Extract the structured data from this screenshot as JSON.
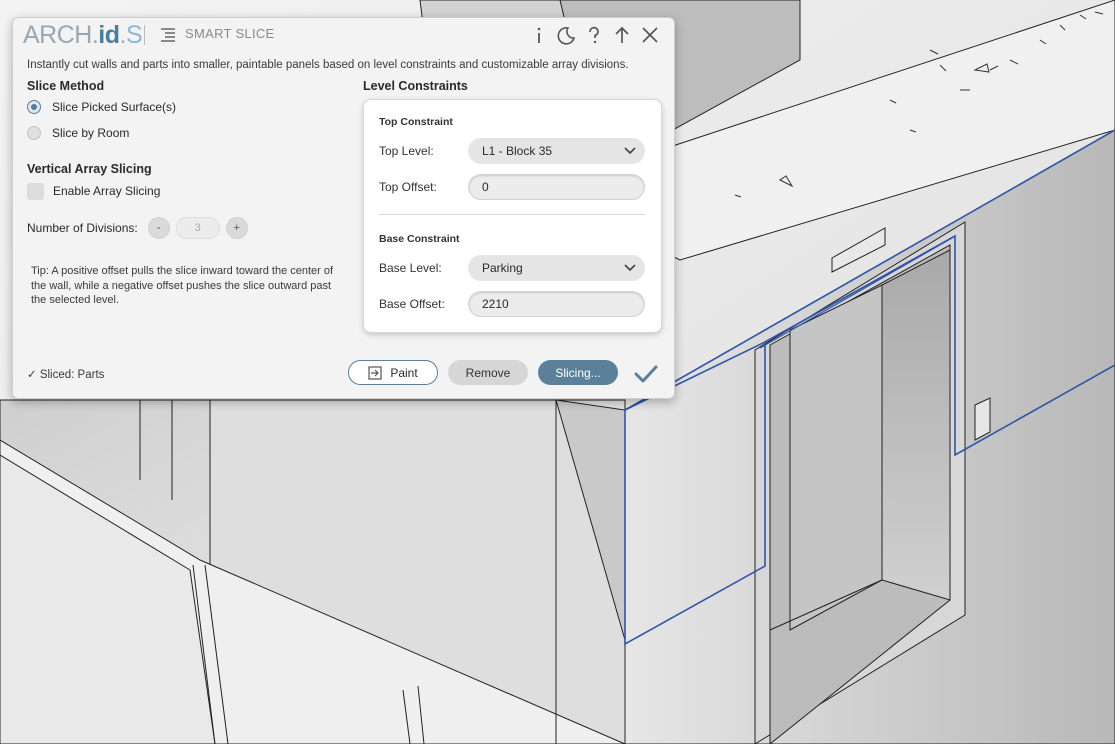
{
  "app": {
    "logo_prefix": "ARCH.",
    "logo_mid": "id",
    "logo_suffix": ".S",
    "title": "SMART SLICE",
    "description": "Instantly cut walls and parts into smaller, paintable panels based on level constraints and customizable array divisions."
  },
  "titlebar_icons": [
    "menu-icon",
    "info-icon",
    "dark-mode-icon",
    "help-icon",
    "collapse-icon",
    "close-icon"
  ],
  "slice_method": {
    "label": "Slice Method",
    "options": [
      {
        "label": "Slice Picked Surface(s)",
        "selected": true
      },
      {
        "label": "Slice by Room",
        "selected": false
      }
    ]
  },
  "vertical_array": {
    "label": "Vertical Array Slicing",
    "enable_label": "Enable Array Slicing",
    "enabled": false,
    "divisions_label": "Number of Divisions:",
    "minus_label": "-",
    "plus_label": "+",
    "divisions_value": "3"
  },
  "tip": "Tip: A positive offset pulls the slice inward toward the center of the wall, while a negative offset pushes the slice outward past the selected level.",
  "level_constraints": {
    "label": "Level Constraints",
    "top": {
      "heading": "Top Constraint",
      "level_label": "Top Level:",
      "level_value": "L1 - Block 35",
      "offset_label": "Top Offset:",
      "offset_value": "0"
    },
    "base": {
      "heading": "Base Constraint",
      "level_label": "Base Level:",
      "level_value": "Parking",
      "offset_label": "Base Offset:",
      "offset_value": "2210"
    }
  },
  "footer": {
    "status": "✓ Sliced: Parts",
    "paint_label": "Paint",
    "remove_label": "Remove",
    "slicing_label": "Slicing..."
  },
  "colors": {
    "accent": "#5b8099",
    "model_edge_highlight": "#2f55a8"
  }
}
